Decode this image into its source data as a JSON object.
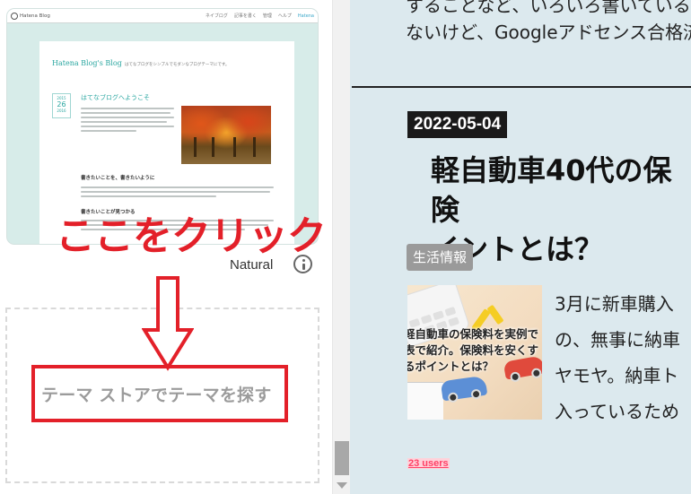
{
  "theme_panel": {
    "preview": {
      "topbar_logo": "Hatena Blog",
      "topbar_nav": [
        "ネイブログ",
        "記事を書く",
        "管理",
        "ヘルプ",
        "Hatena"
      ],
      "blog_title": "Hatena Blog's Blog",
      "tagline": "はてなブログをシンプルでモダンなブログテーマにです。",
      "date": {
        "year": "2015",
        "day": "26",
        "month": "2016"
      },
      "entry_title": "はてなブログへようこそ",
      "subheadings": [
        "書きたいことを、書きたいように",
        "書きたいことが見つかる"
      ]
    },
    "annotation": "ここをクリック",
    "theme_name": "Natural",
    "info_icon": "info-icon",
    "store_link": "テーマ ストアでテーマを探す",
    "accent_color": "#e32029"
  },
  "blog": {
    "previous_text": [
      "することなど、いろいろ書いている結",
      "ないけど、Googleアドセンス合格済"
    ],
    "date": "2022-05-04",
    "title": "軽自動車40代の保険料ポイントとは？",
    "title_lines": [
      "軽自動車40代の保険",
      "イントとは？"
    ],
    "category": "生活情報",
    "thumbnail_text": [
      "軽自動車の保険料を実例で",
      "表で紹介。保険料を安くす",
      "るポイントとは？"
    ],
    "excerpt_lines": [
      "3月に新車購入",
      "の、無事に納車",
      "ヤモヤ。納車ト",
      "入っているため"
    ],
    "bookmark": "23 users"
  }
}
